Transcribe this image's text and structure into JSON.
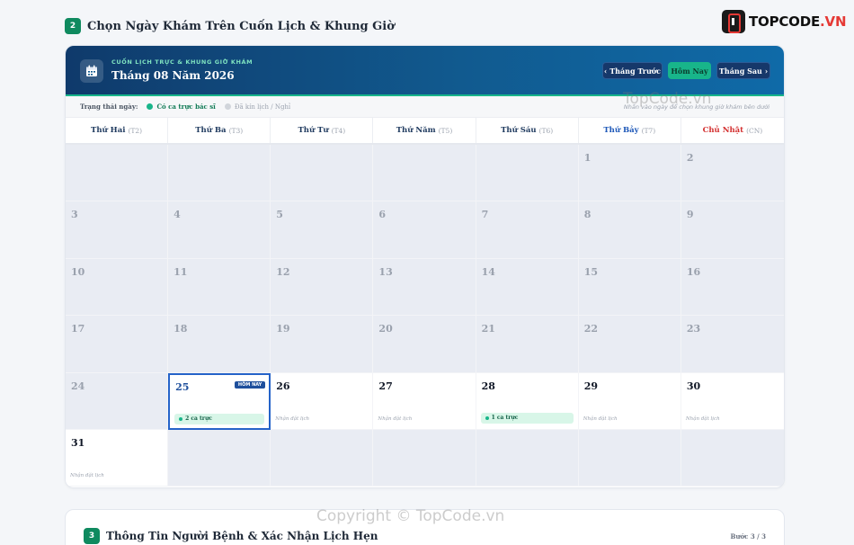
{
  "step2": {
    "number": "2",
    "title": "Chọn Ngày Khám Trên Cuốn Lịch & Khung Giờ"
  },
  "logo": {
    "text_main": "TOPCODE",
    "text_suffix": ".VN"
  },
  "calendar": {
    "subtitle": "CUỐN LỊCH TRỰC & KHUNG GIỜ KHÁM",
    "title": "Tháng 08 Năm 2026",
    "buttons": {
      "prev": "Tháng Trước",
      "today": "Hôm Nay",
      "next": "Tháng Sau"
    },
    "legend": {
      "label": "Trạng thái ngày:",
      "available": "Có ca trực bác sĩ",
      "unavailable": "Đã kín lịch / Nghỉ",
      "hint": "Nhấn vào ngày để chọn khung giờ khám bên dưới"
    },
    "weekdays": [
      {
        "name": "Thứ Hai",
        "abbr": "(T2)"
      },
      {
        "name": "Thứ Ba",
        "abbr": "(T3)"
      },
      {
        "name": "Thứ Tư",
        "abbr": "(T4)"
      },
      {
        "name": "Thứ Năm",
        "abbr": "(T5)"
      },
      {
        "name": "Thứ Sáu",
        "abbr": "(T6)"
      },
      {
        "name": "Thứ Bảy",
        "abbr": "(T7)"
      },
      {
        "name": "Chủ Nhật",
        "abbr": "(CN)"
      }
    ],
    "today_badge": "HÔM NAY",
    "days": [
      {
        "day": ""
      },
      {
        "day": ""
      },
      {
        "day": ""
      },
      {
        "day": ""
      },
      {
        "day": ""
      },
      {
        "day": "1"
      },
      {
        "day": "2"
      },
      {
        "day": "3"
      },
      {
        "day": "4"
      },
      {
        "day": "5"
      },
      {
        "day": "6"
      },
      {
        "day": "7"
      },
      {
        "day": "8"
      },
      {
        "day": "9"
      },
      {
        "day": "10"
      },
      {
        "day": "11"
      },
      {
        "day": "12"
      },
      {
        "day": "13"
      },
      {
        "day": "14"
      },
      {
        "day": "15"
      },
      {
        "day": "16"
      },
      {
        "day": "17"
      },
      {
        "day": "18"
      },
      {
        "day": "19"
      },
      {
        "day": "20"
      },
      {
        "day": "21"
      },
      {
        "day": "22"
      },
      {
        "day": "23"
      },
      {
        "day": "24"
      },
      {
        "day": "25",
        "status": "available",
        "today": true,
        "shift": "2 ca trực"
      },
      {
        "day": "26",
        "status": "available",
        "note": "Nhận đặt lịch"
      },
      {
        "day": "27",
        "status": "available",
        "note": "Nhận đặt lịch"
      },
      {
        "day": "28",
        "status": "available",
        "shift": "1 ca trực"
      },
      {
        "day": "29",
        "status": "available",
        "note": "Nhận đặt lịch"
      },
      {
        "day": "30",
        "status": "available",
        "note": "Nhận đặt lịch"
      },
      {
        "day": "31",
        "status": "available",
        "note": "Nhận đặt lịch"
      },
      {
        "day": ""
      },
      {
        "day": ""
      },
      {
        "day": ""
      },
      {
        "day": ""
      },
      {
        "day": ""
      },
      {
        "day": ""
      }
    ]
  },
  "step3": {
    "number": "3",
    "title": "Thông Tin Người Bệnh & Xác Nhận Lịch Hẹn",
    "counter": "Bước 3 / 3"
  },
  "watermarks": {
    "top": "TopCode.vn",
    "bottom": "Copyright © TopCode.vn"
  },
  "colors": {
    "brand_green": "#18b58a",
    "header_blue": "#0f3a6b",
    "today_blue": "#2563c9",
    "sunday_red": "#d32f2f"
  }
}
